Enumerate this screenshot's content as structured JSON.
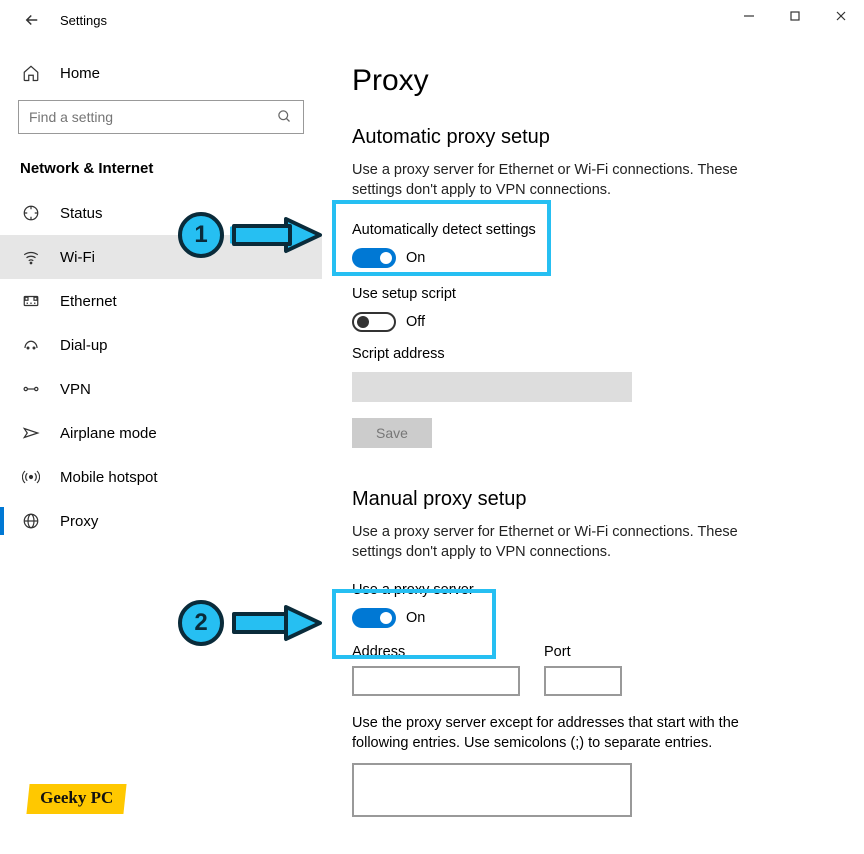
{
  "window": {
    "title": "Settings"
  },
  "sidebar": {
    "home": "Home",
    "search_placeholder": "Find a setting",
    "section": "Network & Internet",
    "items": [
      {
        "icon": "status",
        "label": "Status"
      },
      {
        "icon": "wifi",
        "label": "Wi-Fi"
      },
      {
        "icon": "ethernet",
        "label": "Ethernet"
      },
      {
        "icon": "dialup",
        "label": "Dial-up"
      },
      {
        "icon": "vpn",
        "label": "VPN"
      },
      {
        "icon": "airplane",
        "label": "Airplane mode"
      },
      {
        "icon": "hotspot",
        "label": "Mobile hotspot"
      },
      {
        "icon": "proxy",
        "label": "Proxy"
      }
    ]
  },
  "main": {
    "title": "Proxy",
    "auto": {
      "heading": "Automatic proxy setup",
      "desc": "Use a proxy server for Ethernet or Wi-Fi connections. These settings don't apply to VPN connections.",
      "detect_label": "Automatically detect settings",
      "detect_state": "On",
      "script_label": "Use setup script",
      "script_state": "Off",
      "script_addr_label": "Script address",
      "script_addr_value": "",
      "save_label": "Save"
    },
    "manual": {
      "heading": "Manual proxy setup",
      "desc": "Use a proxy server for Ethernet or Wi-Fi connections. These settings don't apply to VPN connections.",
      "use_label": "Use a proxy server",
      "use_state": "On",
      "address_label": "Address",
      "address_value": "",
      "port_label": "Port",
      "port_value": "",
      "except_label": "Use the proxy server except for addresses that start with the following entries. Use semicolons (;) to separate entries.",
      "except_value": ""
    }
  },
  "annotations": {
    "n1": "1",
    "n2": "2"
  },
  "watermark": "Geeky PC"
}
